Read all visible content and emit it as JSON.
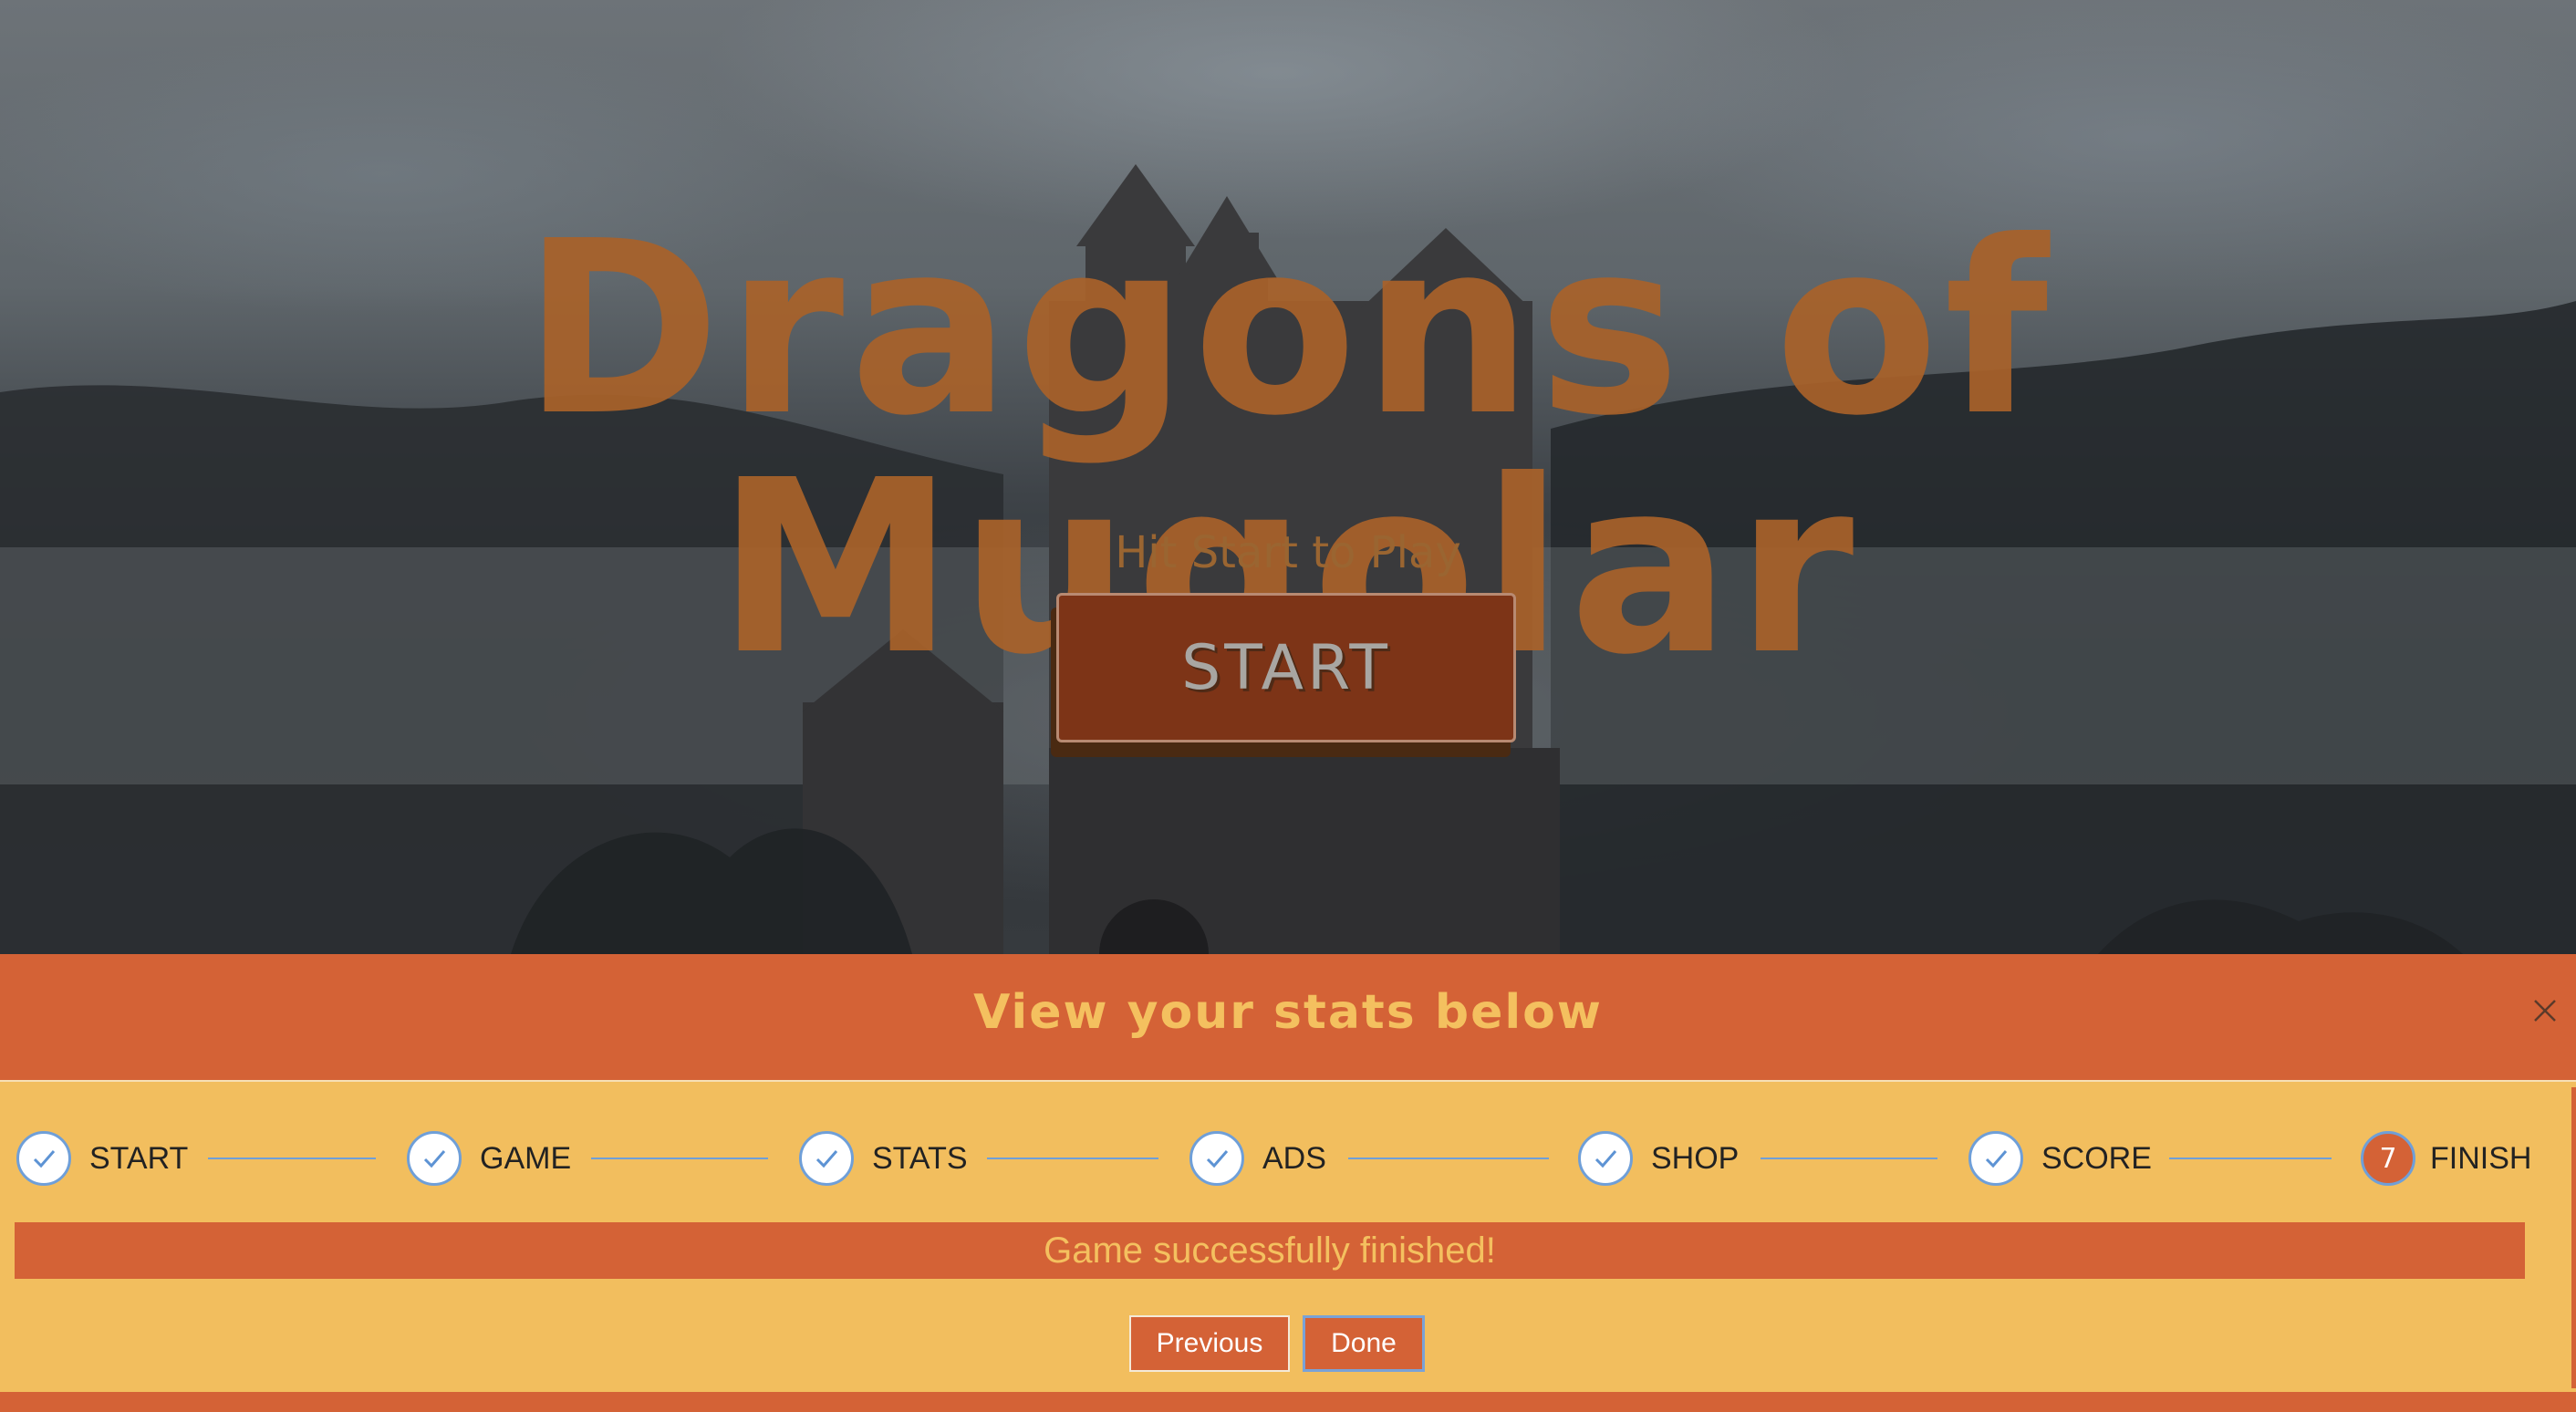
{
  "game": {
    "title": "Dragons of Mugolar",
    "subtitle": "Hit Start to Play",
    "start_label": "START"
  },
  "tour": {
    "title": "View your stats below",
    "close_glyph": "×",
    "steps": [
      {
        "label": "START",
        "state": "completed"
      },
      {
        "label": "GAME",
        "state": "completed"
      },
      {
        "label": "STATS",
        "state": "completed"
      },
      {
        "label": "ADS",
        "state": "completed"
      },
      {
        "label": "SHOP",
        "state": "completed"
      },
      {
        "label": "SCORE",
        "state": "completed"
      },
      {
        "label": "FINISH",
        "state": "current",
        "number": "7"
      }
    ],
    "status_message": "Game successfully finished!",
    "previous_label": "Previous",
    "done_label": "Done"
  },
  "colors": {
    "accent": "#d46236",
    "panel": "#f2be5e",
    "title_text": "#a9622a",
    "tour_title_text": "#f4c05f",
    "step_ring": "#6f9fd8",
    "start_button": "#7d3417"
  },
  "icons": {
    "completed_step": "check-icon",
    "close": "close-icon"
  }
}
